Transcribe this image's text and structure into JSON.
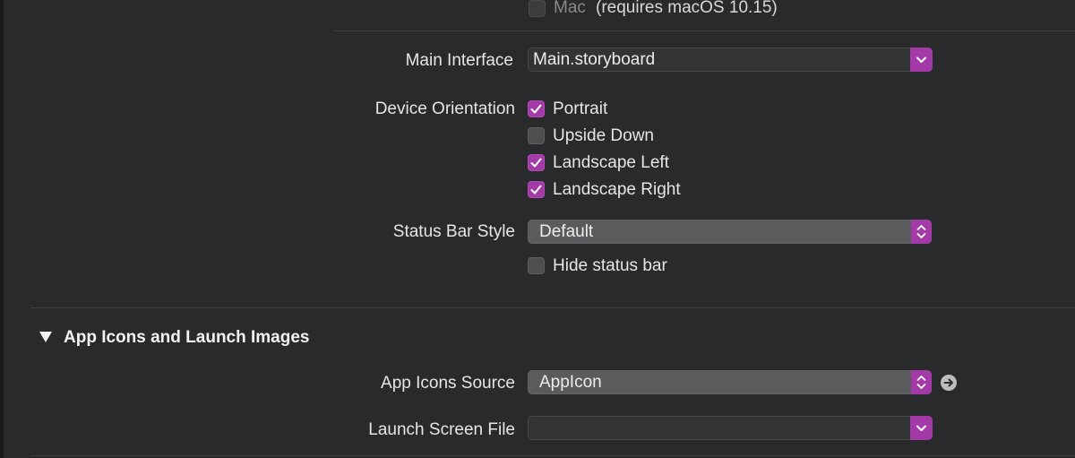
{
  "mac": {
    "checkbox_label": "Mac",
    "note": "(requires macOS 10.15)",
    "checked": false
  },
  "main_interface": {
    "label": "Main Interface",
    "value": "Main.storyboard"
  },
  "device_orientation": {
    "label": "Device Orientation",
    "options": [
      {
        "label": "Portrait",
        "checked": true
      },
      {
        "label": "Upside Down",
        "checked": false
      },
      {
        "label": "Landscape Left",
        "checked": true
      },
      {
        "label": "Landscape Right",
        "checked": true
      }
    ]
  },
  "status_bar_style": {
    "label": "Status Bar Style",
    "value": "Default"
  },
  "hide_status_bar": {
    "label": "Hide status bar",
    "checked": false
  },
  "section": {
    "title": "App Icons and Launch Images",
    "expanded": true
  },
  "app_icons_source": {
    "label": "App Icons Source",
    "value": "AppIcon"
  },
  "launch_screen_file": {
    "label": "Launch Screen File",
    "value": ""
  },
  "colors": {
    "accent": "#a43aa8",
    "background": "#292a2c"
  }
}
